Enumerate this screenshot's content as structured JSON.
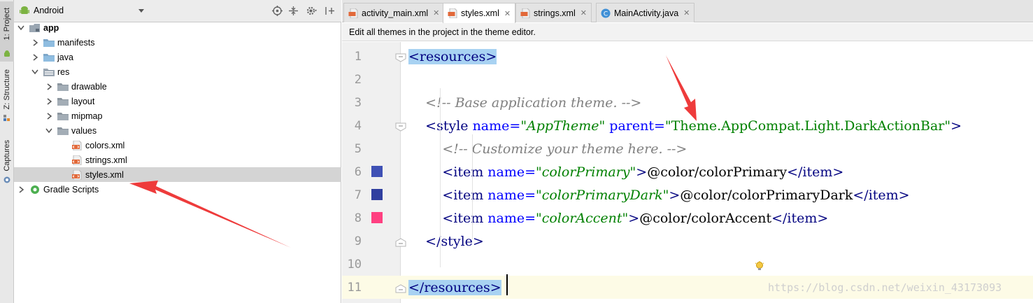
{
  "tool_strip": {
    "project_label": "1: Project",
    "structure_label": "Z: Structure",
    "captures_label": "Captures"
  },
  "project_panel": {
    "view_label": "Android",
    "tree": [
      {
        "label": "app",
        "type": "module",
        "depth": 0,
        "expanded": true,
        "bold": true
      },
      {
        "label": "manifests",
        "type": "folder",
        "depth": 1,
        "expanded": false
      },
      {
        "label": "java",
        "type": "folder",
        "depth": 1,
        "expanded": false
      },
      {
        "label": "res",
        "type": "res-folder",
        "depth": 1,
        "expanded": true
      },
      {
        "label": "drawable",
        "type": "folder-gray",
        "depth": 2,
        "expanded": false
      },
      {
        "label": "layout",
        "type": "folder-gray",
        "depth": 2,
        "expanded": false
      },
      {
        "label": "mipmap",
        "type": "folder-gray",
        "depth": 2,
        "expanded": false
      },
      {
        "label": "values",
        "type": "folder-gray",
        "depth": 2,
        "expanded": true
      },
      {
        "label": "colors.xml",
        "type": "xml",
        "depth": 3
      },
      {
        "label": "strings.xml",
        "type": "xml",
        "depth": 3
      },
      {
        "label": "styles.xml",
        "type": "xml",
        "depth": 3,
        "selected": true
      },
      {
        "label": "Gradle Scripts",
        "type": "gradle",
        "depth": 0,
        "expanded": false
      }
    ]
  },
  "editor": {
    "tabs": [
      {
        "label": "activity_main.xml",
        "type": "xml",
        "active": false
      },
      {
        "label": "styles.xml",
        "type": "xml",
        "active": true
      },
      {
        "label": "strings.xml",
        "type": "xml",
        "active": false
      },
      {
        "label": "MainActivity.java",
        "type": "java",
        "active": false
      }
    ],
    "notice": "Edit all themes in the project in the theme editor.",
    "swatch_colors": {
      "6": "#3f51b5",
      "7": "#303f9f",
      "8": "#ff4081"
    },
    "lines": [
      {
        "n": "1",
        "parts": [
          {
            "c": "hl tag",
            "t": "<resources>"
          }
        ]
      },
      {
        "n": "2",
        "parts": []
      },
      {
        "n": "3",
        "parts": [
          {
            "c": "com",
            "t": "    <!-- Base application theme. -->"
          }
        ]
      },
      {
        "n": "4",
        "parts": [
          {
            "c": "tag",
            "t": "    <style "
          },
          {
            "c": "attr",
            "t": "name="
          },
          {
            "c": "val",
            "t": "\"AppTheme\""
          },
          {
            "c": "attr",
            "t": " parent="
          },
          {
            "c": "valn",
            "t": "\"Theme.AppCompat.Light.DarkActionBar\""
          },
          {
            "c": "tag",
            "t": ">"
          }
        ]
      },
      {
        "n": "5",
        "parts": [
          {
            "c": "com",
            "t": "        <!-- Customize your theme here. -->"
          }
        ]
      },
      {
        "n": "6",
        "parts": [
          {
            "c": "tag",
            "t": "        <item "
          },
          {
            "c": "attr",
            "t": "name="
          },
          {
            "c": "val",
            "t": "\"colorPrimary\""
          },
          {
            "c": "tag",
            "t": ">"
          },
          {
            "c": "",
            "t": "@color/colorPrimary"
          },
          {
            "c": "tag",
            "t": "</item>"
          }
        ]
      },
      {
        "n": "7",
        "parts": [
          {
            "c": "tag",
            "t": "        <item "
          },
          {
            "c": "attr",
            "t": "name="
          },
          {
            "c": "val",
            "t": "\"colorPrimaryDark\""
          },
          {
            "c": "tag",
            "t": ">"
          },
          {
            "c": "",
            "t": "@color/colorPrimaryDark"
          },
          {
            "c": "tag",
            "t": "</item>"
          }
        ]
      },
      {
        "n": "8",
        "parts": [
          {
            "c": "tag",
            "t": "        <item "
          },
          {
            "c": "attr",
            "t": "name="
          },
          {
            "c": "val",
            "t": "\"colorAccent\""
          },
          {
            "c": "tag",
            "t": ">"
          },
          {
            "c": "",
            "t": "@color/colorAccent"
          },
          {
            "c": "tag",
            "t": "</item>"
          }
        ]
      },
      {
        "n": "9",
        "parts": [
          {
            "c": "tag",
            "t": "    </style>"
          }
        ]
      },
      {
        "n": "10",
        "parts": []
      },
      {
        "n": "11",
        "parts": [
          {
            "c": "hl tag",
            "t": "</resources>"
          }
        ]
      }
    ]
  },
  "watermark": "https://blog.csdn.net/weixin_43173093",
  "colors": {
    "annotation_arrow": "#ee3b3b",
    "selection": "#a8d2f2",
    "xml_tag": "#000080",
    "xml_attr": "#0000ff",
    "xml_value": "#008000",
    "comment": "#808080"
  }
}
